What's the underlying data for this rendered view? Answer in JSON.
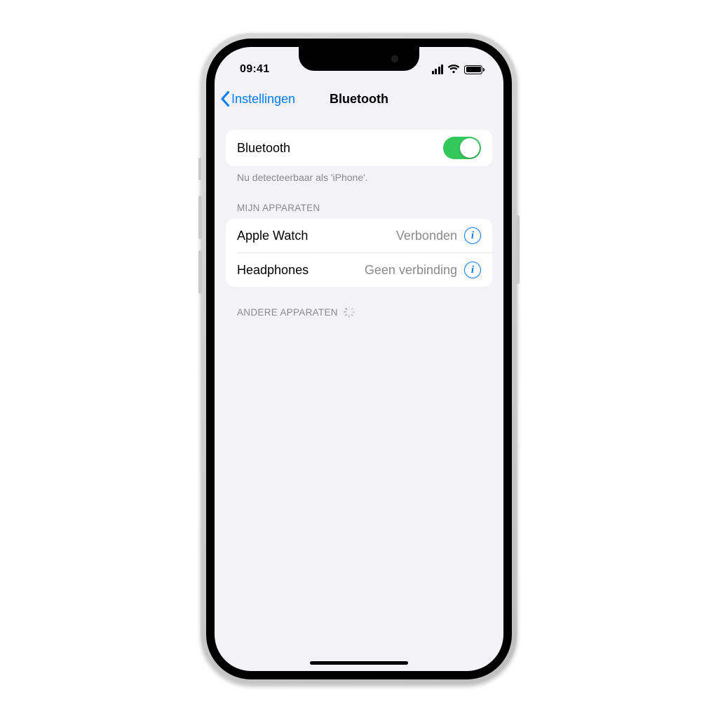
{
  "status": {
    "time": "09:41"
  },
  "nav": {
    "back_label": "Instellingen",
    "title": "Bluetooth"
  },
  "bluetooth": {
    "toggle_label": "Bluetooth",
    "toggle_on": true,
    "discoverable_note": "Nu detecteerbaar als 'iPhone'."
  },
  "sections": {
    "my_devices_header": "MIJN APPARATEN",
    "other_devices_header": "ANDERE APPARATEN"
  },
  "devices": [
    {
      "name": "Apple Watch",
      "status": "Verbonden"
    },
    {
      "name": "Headphones",
      "status": "Geen verbinding"
    }
  ],
  "colors": {
    "accent": "#007aff",
    "toggle_on": "#34c759"
  }
}
